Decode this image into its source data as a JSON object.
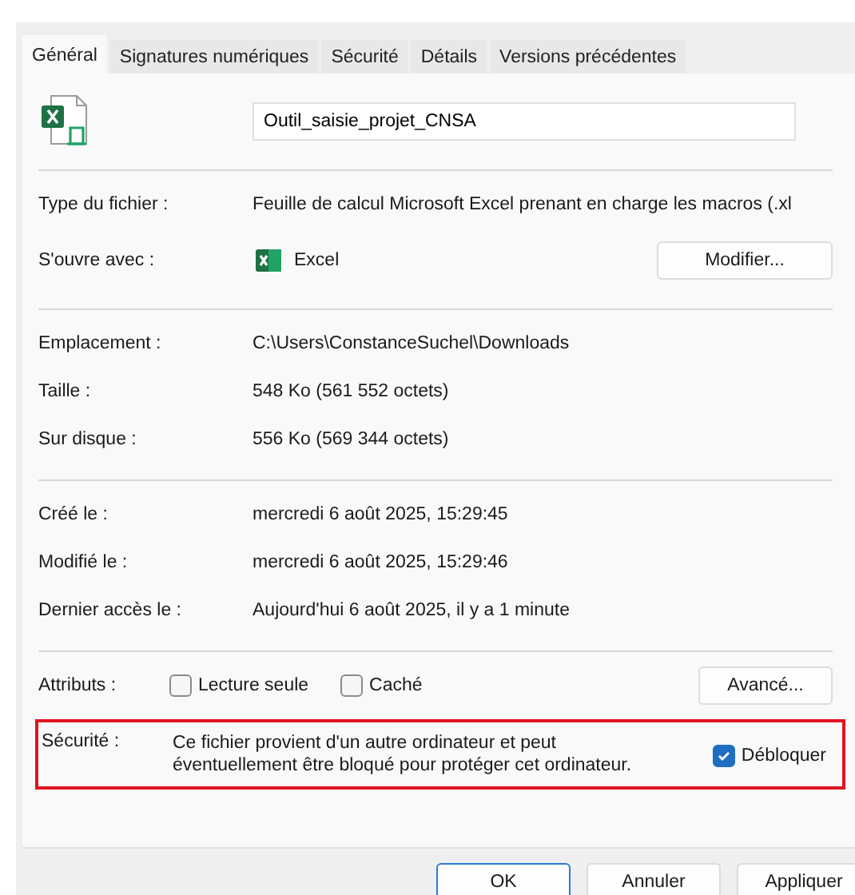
{
  "tabs": [
    {
      "label": "Général",
      "selected": true
    },
    {
      "label": "Signatures numériques",
      "selected": false
    },
    {
      "label": "Sécurité",
      "selected": false
    },
    {
      "label": "Détails",
      "selected": false
    },
    {
      "label": "Versions précédentes",
      "selected": false
    }
  ],
  "file_name": "Outil_saisie_projet_CNSA",
  "type_row": {
    "label": "Type du fichier :",
    "value": "Feuille de calcul Microsoft Excel prenant en charge les macros (.xl"
  },
  "opens_with": {
    "label": "S'ouvre avec :",
    "app": "Excel",
    "button": "Modifier..."
  },
  "location_rows": [
    {
      "label": "Emplacement :",
      "value": "C:\\Users\\ConstanceSuchel\\Downloads"
    },
    {
      "label": "Taille :",
      "value": "548 Ko (561 552 octets)"
    },
    {
      "label": "Sur disque :",
      "value": "556 Ko (569 344 octets)"
    }
  ],
  "date_rows": [
    {
      "label": "Créé le :",
      "value": "mercredi 6 août 2025, 15:29:45"
    },
    {
      "label": "Modifié le :",
      "value": "mercredi 6 août 2025, 15:29:46"
    },
    {
      "label": "Dernier accès le :",
      "value": "Aujourd'hui 6 août 2025, il y a 1 minute"
    }
  ],
  "attributes": {
    "label": "Attributs :",
    "checkboxes": [
      {
        "label": "Lecture seule",
        "checked": false
      },
      {
        "label": "Caché",
        "checked": false
      }
    ],
    "button": "Avancé..."
  },
  "security": {
    "label": "Sécurité :",
    "text": "Ce fichier provient d'un autre ordinateur et peut éventuellement être bloqué pour protéger cet ordinateur.",
    "checkbox": {
      "label": "Débloquer",
      "checked": true
    },
    "highlighted": true
  },
  "buttons": [
    "OK",
    "Annuler",
    "Appliquer"
  ]
}
